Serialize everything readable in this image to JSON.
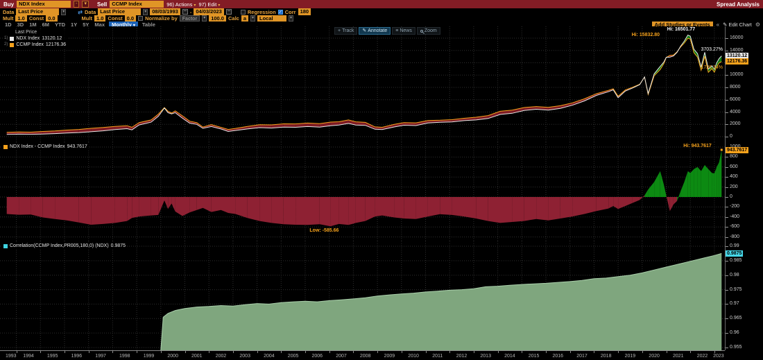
{
  "topbar": {
    "buy_label": "Buy",
    "buy_value": "NDX Index",
    "operator": "-",
    "sell_label": "Sell",
    "sell_value": "CCMP Index",
    "actions_label": "96) Actions",
    "edit_label": "97) Edit",
    "title": "Spread Analysis"
  },
  "controls": {
    "data1_label": "Data",
    "data1_value": "Last Price",
    "data2_label": "Data",
    "data2_value": "Last Price",
    "date_from": "08/03/1993",
    "date_range_sep": "-",
    "date_to": "04/03/2023",
    "regression_label": "Regression",
    "corr_label": "Corr",
    "corr_value": "180",
    "corr_check": "✓",
    "mult1_label": "Mult",
    "mult1_value": "1.0",
    "const1_label": "Const",
    "const1_value": "0.0",
    "mult2_label": "Mult",
    "mult2_value": "1.0",
    "const2_label": "Const",
    "const2_value": "0.0",
    "normalize_label": "Normalize by",
    "factor_value": "Factor",
    "factor_amount": "100.0",
    "calc_label": "Calc",
    "calc_value": "a",
    "locale_value": "Local",
    "periods": [
      "1D",
      "3D",
      "1M",
      "6M",
      "YTD",
      "1Y",
      "5Y",
      "Max"
    ],
    "frequency": "Monthly",
    "table_label": "Table",
    "add_studies_label": "Add Studies or Events",
    "collapse_icon": "«",
    "edit_chart_label": "Edit Chart",
    "edit_chart_pencil": "✎",
    "gear_icon": "⚙",
    "dropdown_icon": "▾"
  },
  "chart_toolbar": {
    "track": "Track",
    "annotate": "Annotate",
    "news": "News",
    "zoom": "Zoom",
    "track_icon": "+",
    "annotate_icon": "✎",
    "news_icon": "≡"
  },
  "legends": {
    "price": {
      "title": "Last Price",
      "rows": [
        {
          "num": "1)",
          "label": "NDX Index",
          "value": "13120.12",
          "color": "#e8e8e8"
        },
        {
          "num": "2)",
          "label": "CCMP Index",
          "value": "12176.36",
          "color": "#f6a21c"
        }
      ],
      "pct_ndx": "3703.27%",
      "pct_ccmp": "1726.34%"
    },
    "spread": {
      "label": "NDX Index - CCMP Index",
      "value": "943.7617",
      "color": "#f6a21c"
    },
    "correlation": {
      "label": "Correlation(CCMP Index,PR005,180,0) (NDX)",
      "value": "0.9875",
      "color": "#3ed3e0"
    }
  },
  "x_axis": {
    "years": [
      1993,
      1994,
      1995,
      1996,
      1997,
      1998,
      1999,
      2000,
      2001,
      2002,
      2003,
      2004,
      2005,
      2006,
      2007,
      2008,
      2009,
      2010,
      2011,
      2012,
      2013,
      2014,
      2015,
      2016,
      2017,
      2018,
      2019,
      2020,
      2021,
      2022,
      2023
    ]
  },
  "colors": {
    "topbar_red": "#831c25",
    "amber": "#e09526",
    "label_orange": "#e8a33d",
    "ndx_line": "#e8e8e8",
    "ccmp_line": "#f6a21c",
    "fill_red_price": "#7e1b24",
    "fill_green_price": "#0f7a16",
    "spread_red": "#8e2133",
    "spread_green": "#0c8a12",
    "corr_fill": "#7fa67e",
    "corr_edge": "#a9cfaa",
    "badge_cyan": "#45d7e8",
    "grid": "#2e2e2e"
  },
  "chart_data": [
    {
      "type": "line",
      "title": "Last Price",
      "panel": "price",
      "ylim": [
        0,
        16000
      ],
      "yticks": [
        16000,
        14000,
        12000,
        10000,
        8000,
        6000,
        4000,
        2000,
        0
      ],
      "x": [
        1993.6,
        1994.1,
        1994.6,
        1995.1,
        1995.6,
        1996.1,
        1996.6,
        1997.1,
        1997.6,
        1998.1,
        1998.6,
        1998.8,
        1999.1,
        1999.6,
        1999.9,
        2000.15,
        2000.3,
        2000.45,
        2000.6,
        2000.9,
        2001.2,
        2001.5,
        2001.75,
        2002.1,
        2002.5,
        2002.8,
        2003.1,
        2003.6,
        2004.1,
        2004.6,
        2005.1,
        2005.6,
        2006.1,
        2006.6,
        2007.05,
        2007.4,
        2007.8,
        2008.1,
        2008.5,
        2008.9,
        2009.2,
        2009.7,
        2010.1,
        2010.6,
        2011.1,
        2011.6,
        2012.1,
        2012.6,
        2013.1,
        2013.6,
        2014.1,
        2014.6,
        2015.1,
        2015.6,
        2016.1,
        2016.6,
        2017.1,
        2017.6,
        2018.1,
        2018.6,
        2018.8,
        2019.0,
        2019.3,
        2019.6,
        2019.9,
        2020.1,
        2020.25,
        2020.5,
        2020.75,
        2020.9,
        2021.0,
        2021.15,
        2021.3,
        2021.45,
        2021.6,
        2021.75,
        2021.9,
        2022.0,
        2022.15,
        2022.3,
        2022.45,
        2022.6,
        2022.75,
        2022.9,
        2023.0,
        2023.1,
        2023.2,
        2023.3
      ],
      "series": [
        {
          "name": "NDX Index",
          "color": "#e8e8e8",
          "last": 13120.12,
          "values": [
            360,
            400,
            385,
            430,
            500,
            600,
            660,
            800,
            950,
            1150,
            1300,
            1100,
            1900,
            2350,
            3300,
            4650,
            3900,
            3700,
            3900,
            3000,
            2200,
            2000,
            1350,
            1650,
            1250,
            850,
            1000,
            1250,
            1467,
            1400,
            1540,
            1520,
            1645,
            1560,
            1780,
            1880,
            2150,
            1890,
            1840,
            1200,
            1150,
            1580,
            1860,
            1800,
            2230,
            2330,
            2400,
            2600,
            2720,
            2950,
            3600,
            3800,
            4250,
            4450,
            4300,
            4600,
            5100,
            5800,
            6700,
            7300,
            7600,
            6329,
            7400,
            7900,
            8450,
            9700,
            6994,
            10200,
            11418,
            12100,
            12888,
            12909,
            13100,
            13700,
            14700,
            15500,
            16501.77,
            16320,
            14200,
            13500,
            11300,
            13700,
            11000,
            11500,
            10939,
            12000,
            12700,
            13120.12
          ]
        },
        {
          "name": "CCMP Index",
          "color": "#f6a21c",
          "last": 12176.36,
          "values": [
            700,
            755,
            735,
            840,
            940,
            1070,
            1170,
            1355,
            1490,
            1670,
            1780,
            1520,
            2290,
            2720,
            3660,
            4720,
            4140,
            3830,
            4190,
            3380,
            2510,
            2260,
            1570,
            1950,
            1510,
            1170,
            1340,
            1670,
            1947,
            1920,
            2085,
            2075,
            2205,
            2105,
            2365.66,
            2420,
            2710,
            2410,
            2320,
            1590,
            1520,
            1990,
            2290,
            2240,
            2620,
            2675,
            2760,
            2990,
            3150,
            3430,
            4120,
            4300,
            4730,
            4890,
            4770,
            5030,
            5490,
            6140,
            6980,
            7530,
            7780,
            6569,
            7580,
            8020,
            8510,
            9670,
            6844,
            9900,
            10898,
            11850,
            12858,
            13192,
            13250,
            13780,
            14580,
            15200,
            15985.77,
            15840,
            13640,
            12900,
            10780,
            13060,
            10440,
            11020,
            10466,
            11400,
            12000,
            12176.36
          ]
        }
      ],
      "annotations": [
        {
          "text": "Hi: 16501.77",
          "x": 2021.9,
          "y": 16501.77,
          "color": "#ffffff"
        },
        {
          "text": "Hi: 15832.80",
          "x": 2021.87,
          "y": 15832.8,
          "color": "#f6a21c"
        }
      ]
    },
    {
      "type": "area",
      "name": "NDX Index - CCMP Index",
      "panel": "spread",
      "last": 943.7617,
      "ylim": [
        -800,
        1000
      ],
      "yticks": [
        1000,
        800,
        600,
        400,
        200,
        0,
        -200,
        -400,
        -600,
        -800
      ],
      "x": [
        1993.6,
        1994.1,
        1994.6,
        1995.1,
        1995.6,
        1996.1,
        1996.6,
        1997.1,
        1997.6,
        1998.1,
        1998.6,
        1998.8,
        1999.1,
        1999.6,
        1999.9,
        2000.15,
        2000.3,
        2000.45,
        2000.6,
        2000.9,
        2001.2,
        2001.5,
        2001.75,
        2002.1,
        2002.5,
        2002.8,
        2003.1,
        2003.6,
        2004.1,
        2004.6,
        2005.1,
        2005.6,
        2006.1,
        2006.6,
        2007.05,
        2007.4,
        2007.8,
        2008.1,
        2008.5,
        2008.9,
        2009.2,
        2009.7,
        2010.1,
        2010.6,
        2011.1,
        2011.6,
        2012.1,
        2012.6,
        2013.1,
        2013.6,
        2014.1,
        2014.6,
        2015.1,
        2015.6,
        2016.1,
        2016.6,
        2017.1,
        2017.6,
        2018.1,
        2018.6,
        2018.8,
        2019.0,
        2019.3,
        2019.6,
        2019.9,
        2020.1,
        2020.25,
        2020.5,
        2020.75,
        2020.9,
        2021.0,
        2021.15,
        2021.3,
        2021.45,
        2021.6,
        2021.75,
        2021.9,
        2022.0,
        2022.15,
        2022.3,
        2022.45,
        2022.6,
        2022.75,
        2022.9,
        2023.0,
        2023.1,
        2023.2,
        2023.3
      ],
      "values": [
        -340,
        -355,
        -350,
        -410,
        -440,
        -470,
        -510,
        -555,
        -540,
        -520,
        -480,
        -420,
        -390,
        -370,
        -360,
        -70,
        -240,
        -130,
        -290,
        -380,
        -310,
        -260,
        -220,
        -300,
        -260,
        -320,
        -340,
        -420,
        -480,
        -520,
        -545,
        -555,
        -560,
        -545,
        -585.66,
        -540,
        -560,
        -520,
        -480,
        -390,
        -370,
        -410,
        -430,
        -440,
        -390,
        -345,
        -360,
        -390,
        -430,
        -480,
        -520,
        -500,
        -480,
        -440,
        -470,
        -430,
        -390,
        -340,
        -280,
        -230,
        -180,
        -240,
        -180,
        -120,
        -60,
        30,
        150,
        300,
        520,
        250,
        30,
        -283,
        -150,
        -80,
        120,
        300,
        516,
        480,
        560,
        600,
        520,
        640,
        560,
        480,
        473,
        600,
        700,
        943.7617
      ],
      "annotations": [
        {
          "text": "Hi: 943.7617",
          "x": 2023.3,
          "y": 943.7617,
          "color": "#f6a21c"
        },
        {
          "text": "Low: -585.66",
          "x": 2007.05,
          "y": -585.66,
          "color": "#f6a21c"
        }
      ]
    },
    {
      "type": "area",
      "name": "Correlation(CCMP Index,PR005,180,0) (NDX)",
      "panel": "correlation",
      "last": 0.9875,
      "ylim": [
        0.955,
        0.99
      ],
      "yticks": [
        0.99,
        0.985,
        0.98,
        0.975,
        0.97,
        0.965,
        0.96,
        0.955
      ],
      "x": [
        2000.0,
        2000.1,
        2000.3,
        2000.6,
        2001.0,
        2001.5,
        2002.0,
        2002.5,
        2003.0,
        2003.5,
        2004.0,
        2004.5,
        2005.0,
        2005.5,
        2006.0,
        2006.5,
        2007.0,
        2007.5,
        2008.0,
        2008.5,
        2009.0,
        2009.5,
        2010.0,
        2010.5,
        2011.0,
        2011.5,
        2012.0,
        2012.5,
        2013.0,
        2013.5,
        2014.0,
        2014.5,
        2015.0,
        2015.5,
        2016.0,
        2016.5,
        2017.0,
        2017.5,
        2018.0,
        2018.5,
        2019.0,
        2019.5,
        2020.0,
        2020.5,
        2021.0,
        2021.5,
        2022.0,
        2022.5,
        2023.0,
        2023.3
      ],
      "values": [
        0.953,
        0.9655,
        0.9668,
        0.9678,
        0.9685,
        0.969,
        0.9692,
        0.9695,
        0.9693,
        0.9698,
        0.9702,
        0.97,
        0.9705,
        0.9708,
        0.971,
        0.9708,
        0.9712,
        0.9715,
        0.9718,
        0.9722,
        0.9728,
        0.9732,
        0.9735,
        0.9738,
        0.9742,
        0.9745,
        0.9748,
        0.975,
        0.9753,
        0.976,
        0.9762,
        0.9765,
        0.9768,
        0.977,
        0.9772,
        0.9775,
        0.9778,
        0.9782,
        0.9788,
        0.979,
        0.9795,
        0.98,
        0.9808,
        0.9818,
        0.9828,
        0.9838,
        0.9848,
        0.9858,
        0.9868,
        0.9875
      ],
      "annotations": []
    }
  ]
}
